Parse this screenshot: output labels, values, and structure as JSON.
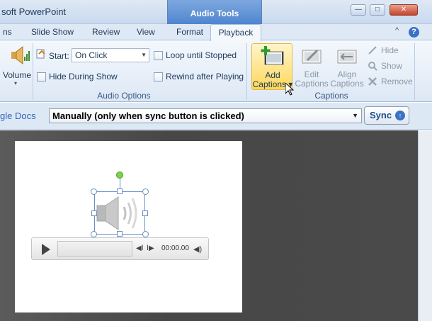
{
  "window": {
    "app_title": "soft PowerPoint",
    "context_tab": "Audio Tools",
    "controls": {
      "minimize": "—",
      "maximize": "□",
      "close": "✕"
    }
  },
  "tabs": [
    {
      "label": "ns"
    },
    {
      "label": "Slide Show"
    },
    {
      "label": "Review"
    },
    {
      "label": "View"
    },
    {
      "label": "Format"
    },
    {
      "label": "Playback",
      "active": true
    }
  ],
  "help": {
    "symbol": "?",
    "chevron": "^"
  },
  "ribbon": {
    "volume": {
      "label": "Volume",
      "arrow": "▾"
    },
    "audio_options": {
      "start_label": "Start:",
      "start_value": "On Click",
      "hide_during_show": "Hide During Show",
      "loop_until_stopped": "Loop until Stopped",
      "rewind_after_playing": "Rewind after Playing",
      "group_label": "Audio Options"
    },
    "captions": {
      "add_line1": "Add",
      "add_line2": "Captions ▾",
      "edit_line1": "Edit",
      "edit_line2": "Captions",
      "align_line1": "Align",
      "align_line2": "Captions",
      "hide": "Hide",
      "show": "Show",
      "remove": "Remove",
      "group_label": "Captions"
    }
  },
  "gdocs": {
    "link": "gle Docs",
    "sync_mode": "Manually (only when sync button is clicked)",
    "sync_button": "Sync",
    "sync_arrow": "↑"
  },
  "player": {
    "time": "00:00.00",
    "prev": "◀Ⅰ",
    "next": "Ⅰ▶",
    "volume": "◀)"
  },
  "colors": {
    "accent": "#3b73c4",
    "ribbon": "#dde8f5",
    "context_tab": "#4f86cf",
    "highlight": "#ffd75a",
    "workspace": "#4a4a4a"
  }
}
